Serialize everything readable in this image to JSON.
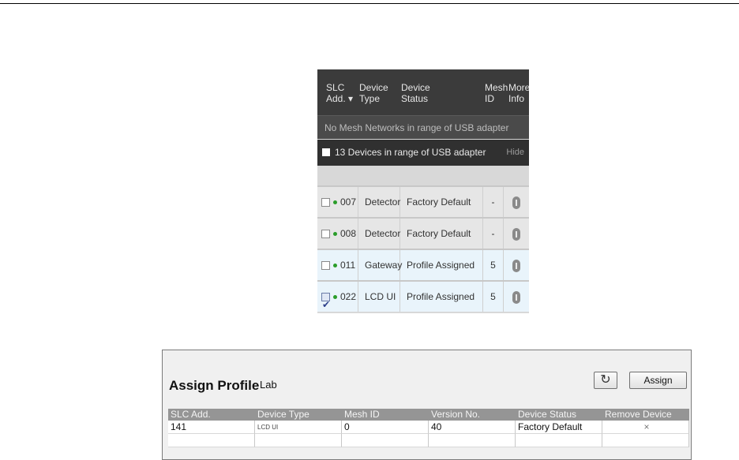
{
  "device_list": {
    "columns": [
      {
        "line1": "SLC",
        "line2": "Add. ▾"
      },
      {
        "line1": "Device",
        "line2": "Type"
      },
      {
        "line1": "Device",
        "line2": "Status"
      },
      {
        "line1": "Mesh",
        "line2": "ID"
      },
      {
        "line1": "More",
        "line2": "Info"
      }
    ],
    "no_mesh_text": "No Mesh Networks in range of USB adapter",
    "in_range_text": "13 Devices in range of USB adapter",
    "hide_label": "Hide",
    "rows": [
      {
        "address": "007",
        "type": "Detector",
        "status": "Factory Default",
        "mesh_id": "-",
        "checked": false,
        "bg": "#e6e6e6"
      },
      {
        "address": "008",
        "type": "Detector",
        "status": "Factory Default",
        "mesh_id": "-",
        "checked": false,
        "bg": "#e6e6e6"
      },
      {
        "address": "011",
        "type": "Gateway",
        "status": "Profile Assigned",
        "mesh_id": "5",
        "checked": false,
        "bg": "#e9f4fb"
      },
      {
        "address": "022",
        "type": "LCD UI",
        "status": "Profile Assigned",
        "mesh_id": "5",
        "checked": true,
        "bg": "#e9f4fb"
      }
    ]
  },
  "assign_profile": {
    "title": "Assign Profile",
    "profile_name": "Lab",
    "refresh_icon": "refresh-icon",
    "assign_label": "Assign",
    "columns": [
      "SLC Add.",
      "Device Type",
      "Mesh ID",
      "Version No.",
      "Device Status",
      "Remove Device"
    ],
    "rows": [
      {
        "slc": "141",
        "type": "LCD UI",
        "mesh": "0",
        "version": "40",
        "status": "Factory Default",
        "remove": "×"
      }
    ]
  },
  "colors": {
    "status_dot": "#2a9d2a",
    "header_dark": "#3b3b3b"
  }
}
